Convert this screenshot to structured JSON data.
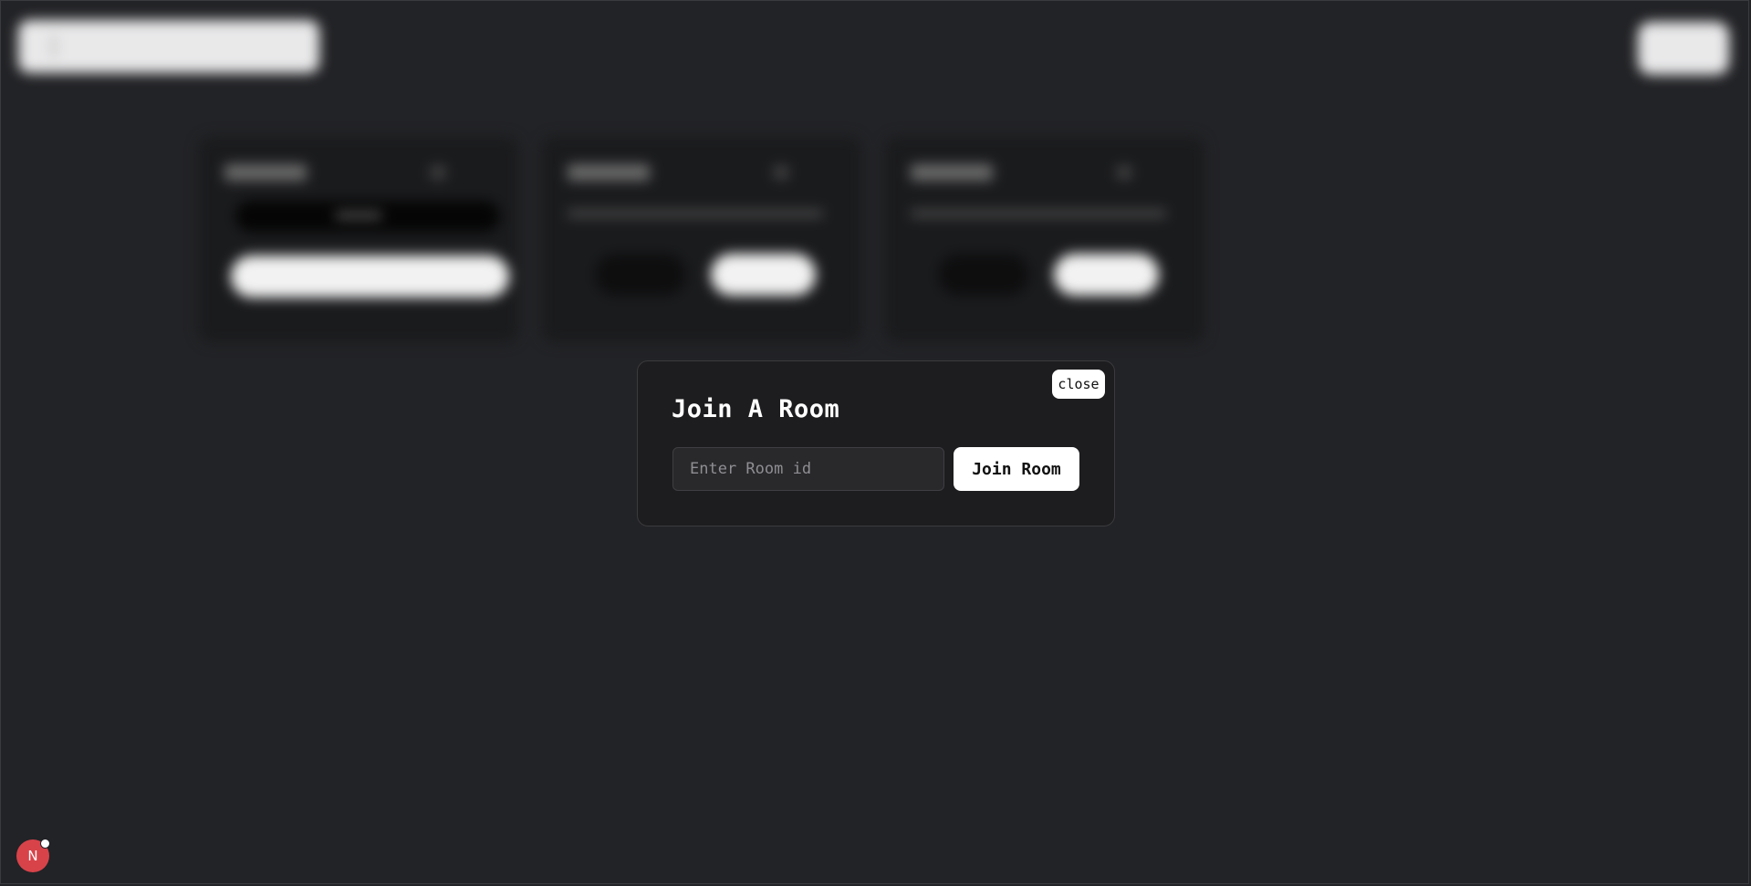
{
  "modal": {
    "title": "Join A Room",
    "close_label": "close",
    "input_placeholder": "Enter Room id",
    "input_value": "",
    "join_label": "Join Room"
  },
  "dev_badge": {
    "label": "N"
  },
  "colors": {
    "background": "#222326",
    "modal_background": "#1d1d1f",
    "button": "#ffffff",
    "badge": "#d8434a"
  }
}
